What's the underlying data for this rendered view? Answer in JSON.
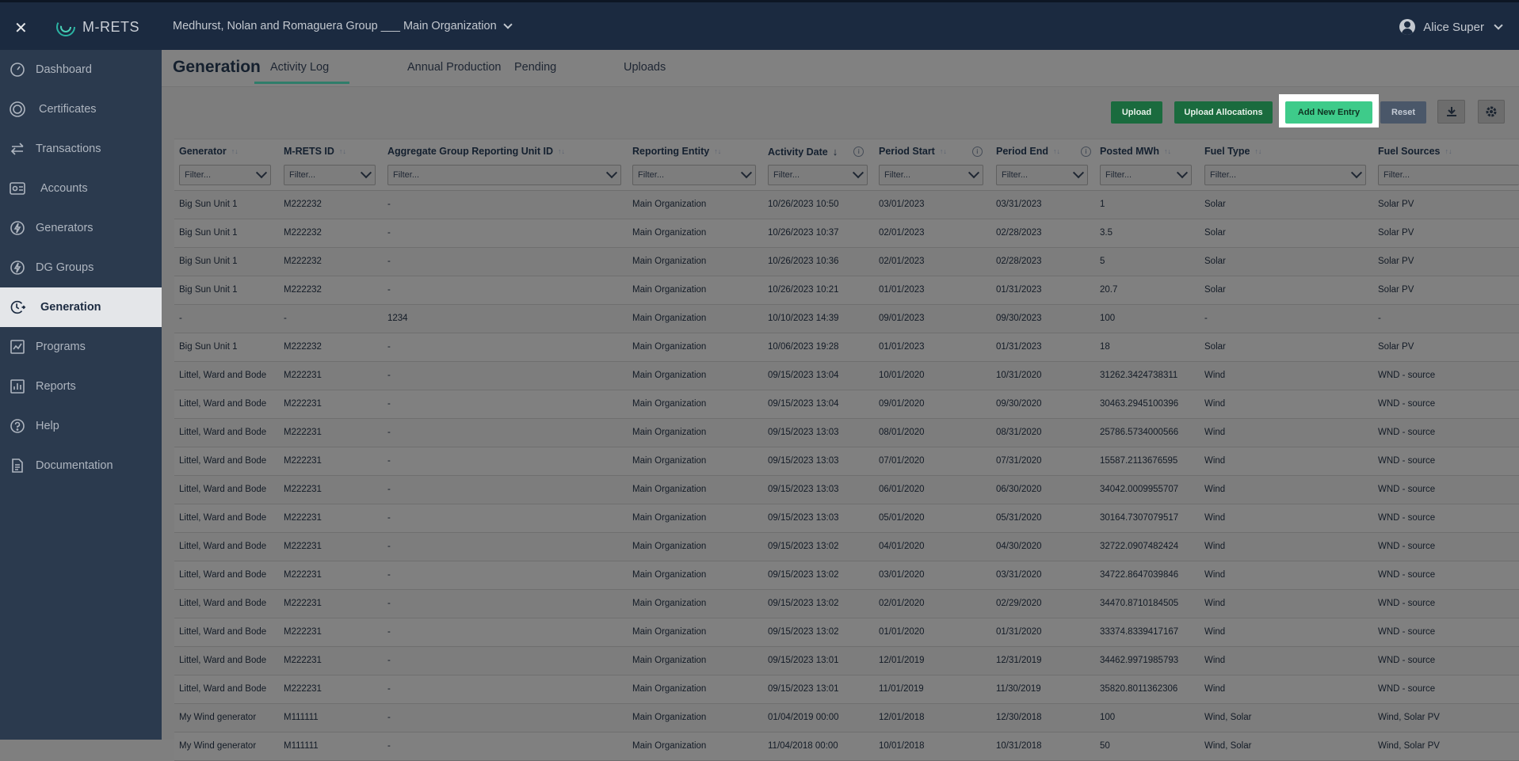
{
  "topbar": {
    "close_icon": "close-icon",
    "logo_text": "M-RETS",
    "org_label": "Medhurst, Nolan and Romaguera Group ___ Main Organization",
    "user_name": "Alice Super"
  },
  "sidebar": {
    "items": [
      {
        "label": "Dashboard",
        "icon": "dashboard-icon"
      },
      {
        "label": "Certificates",
        "icon": "certificate-icon"
      },
      {
        "label": "Transactions",
        "icon": "transfer-icon"
      },
      {
        "label": "Accounts",
        "icon": "accounts-icon"
      },
      {
        "label": "Generators",
        "icon": "lightning-icon"
      },
      {
        "label": "DG Groups",
        "icon": "lightning-group-icon"
      },
      {
        "label": "Generation",
        "icon": "generation-icon"
      },
      {
        "label": "Programs",
        "icon": "programs-icon"
      },
      {
        "label": "Reports",
        "icon": "reports-icon"
      },
      {
        "label": "Help",
        "icon": "help-icon"
      },
      {
        "label": "Documentation",
        "icon": "documentation-icon"
      }
    ],
    "active": "Generation"
  },
  "page": {
    "title": "Generation",
    "tabs": [
      "Activity Log",
      "Annual Production",
      "Pending",
      "Uploads"
    ],
    "active_tab": "Activity Log"
  },
  "toolbar": {
    "upload": "Upload",
    "upload_allocations": "Upload Allocations",
    "add_new_entry": "Add New Entry",
    "reset": "Reset",
    "download_icon": "download-icon",
    "settings_icon": "gear-icon"
  },
  "table": {
    "filter_placeholder": "Filter...",
    "columns": [
      "Generator",
      "M-RETS ID",
      "Aggregate Group Reporting Unit ID",
      "Reporting Entity",
      "Activity Date",
      "Period Start",
      "Period End",
      "Posted MWh",
      "Fuel Type",
      "Fuel Sources"
    ],
    "rows": [
      [
        "Big Sun Unit 1",
        "M222232",
        "-",
        "Main Organization",
        "10/26/2023 10:50",
        "03/01/2023",
        "03/31/2023",
        "1",
        "Solar",
        "Solar PV"
      ],
      [
        "Big Sun Unit 1",
        "M222232",
        "-",
        "Main Organization",
        "10/26/2023 10:37",
        "02/01/2023",
        "02/28/2023",
        "3.5",
        "Solar",
        "Solar PV"
      ],
      [
        "Big Sun Unit 1",
        "M222232",
        "-",
        "Main Organization",
        "10/26/2023 10:36",
        "02/01/2023",
        "02/28/2023",
        "5",
        "Solar",
        "Solar PV"
      ],
      [
        "Big Sun Unit 1",
        "M222232",
        "-",
        "Main Organization",
        "10/26/2023 10:21",
        "01/01/2023",
        "01/31/2023",
        "20.7",
        "Solar",
        "Solar PV"
      ],
      [
        "-",
        "-",
        "1234",
        "Main Organization",
        "10/10/2023 14:39",
        "09/01/2023",
        "09/30/2023",
        "100",
        "-",
        "-"
      ],
      [
        "Big Sun Unit 1",
        "M222232",
        "-",
        "Main Organization",
        "10/06/2023 19:28",
        "01/01/2023",
        "01/31/2023",
        "18",
        "Solar",
        "Solar PV"
      ],
      [
        "Littel, Ward and Bode",
        "M222231",
        "-",
        "Main Organization",
        "09/15/2023 13:04",
        "10/01/2020",
        "10/31/2020",
        "31262.3424738311",
        "Wind",
        "WND - source"
      ],
      [
        "Littel, Ward and Bode",
        "M222231",
        "-",
        "Main Organization",
        "09/15/2023 13:04",
        "09/01/2020",
        "09/30/2020",
        "30463.2945100396",
        "Wind",
        "WND - source"
      ],
      [
        "Littel, Ward and Bode",
        "M222231",
        "-",
        "Main Organization",
        "09/15/2023 13:03",
        "08/01/2020",
        "08/31/2020",
        "25786.5734000566",
        "Wind",
        "WND - source"
      ],
      [
        "Littel, Ward and Bode",
        "M222231",
        "-",
        "Main Organization",
        "09/15/2023 13:03",
        "07/01/2020",
        "07/31/2020",
        "15587.2113676595",
        "Wind",
        "WND - source"
      ],
      [
        "Littel, Ward and Bode",
        "M222231",
        "-",
        "Main Organization",
        "09/15/2023 13:03",
        "06/01/2020",
        "06/30/2020",
        "34042.0009955707",
        "Wind",
        "WND - source"
      ],
      [
        "Littel, Ward and Bode",
        "M222231",
        "-",
        "Main Organization",
        "09/15/2023 13:03",
        "05/01/2020",
        "05/31/2020",
        "30164.7307079517",
        "Wind",
        "WND - source"
      ],
      [
        "Littel, Ward and Bode",
        "M222231",
        "-",
        "Main Organization",
        "09/15/2023 13:02",
        "04/01/2020",
        "04/30/2020",
        "32722.0907482424",
        "Wind",
        "WND - source"
      ],
      [
        "Littel, Ward and Bode",
        "M222231",
        "-",
        "Main Organization",
        "09/15/2023 13:02",
        "03/01/2020",
        "03/31/2020",
        "34722.8647039846",
        "Wind",
        "WND - source"
      ],
      [
        "Littel, Ward and Bode",
        "M222231",
        "-",
        "Main Organization",
        "09/15/2023 13:02",
        "02/01/2020",
        "02/29/2020",
        "34470.8710184505",
        "Wind",
        "WND - source"
      ],
      [
        "Littel, Ward and Bode",
        "M222231",
        "-",
        "Main Organization",
        "09/15/2023 13:02",
        "01/01/2020",
        "01/31/2020",
        "33374.8339417167",
        "Wind",
        "WND - source"
      ],
      [
        "Littel, Ward and Bode",
        "M222231",
        "-",
        "Main Organization",
        "09/15/2023 13:01",
        "12/01/2019",
        "12/31/2019",
        "34462.9971985793",
        "Wind",
        "WND - source"
      ],
      [
        "Littel, Ward and Bode",
        "M222231",
        "-",
        "Main Organization",
        "09/15/2023 13:01",
        "11/01/2019",
        "11/30/2019",
        "35820.8011362306",
        "Wind",
        "WND - source"
      ],
      [
        "My Wind generator",
        "M111111",
        "-",
        "Main Organization",
        "01/04/2019 00:00",
        "12/01/2018",
        "12/30/2018",
        "100",
        "Wind, Solar",
        "Wind, Solar PV"
      ],
      [
        "My Wind generator",
        "M111111",
        "-",
        "Main Organization",
        "11/04/2018 00:00",
        "10/01/2018",
        "10/31/2018",
        "50",
        "Wind, Solar",
        "Wind, Solar PV"
      ]
    ]
  }
}
